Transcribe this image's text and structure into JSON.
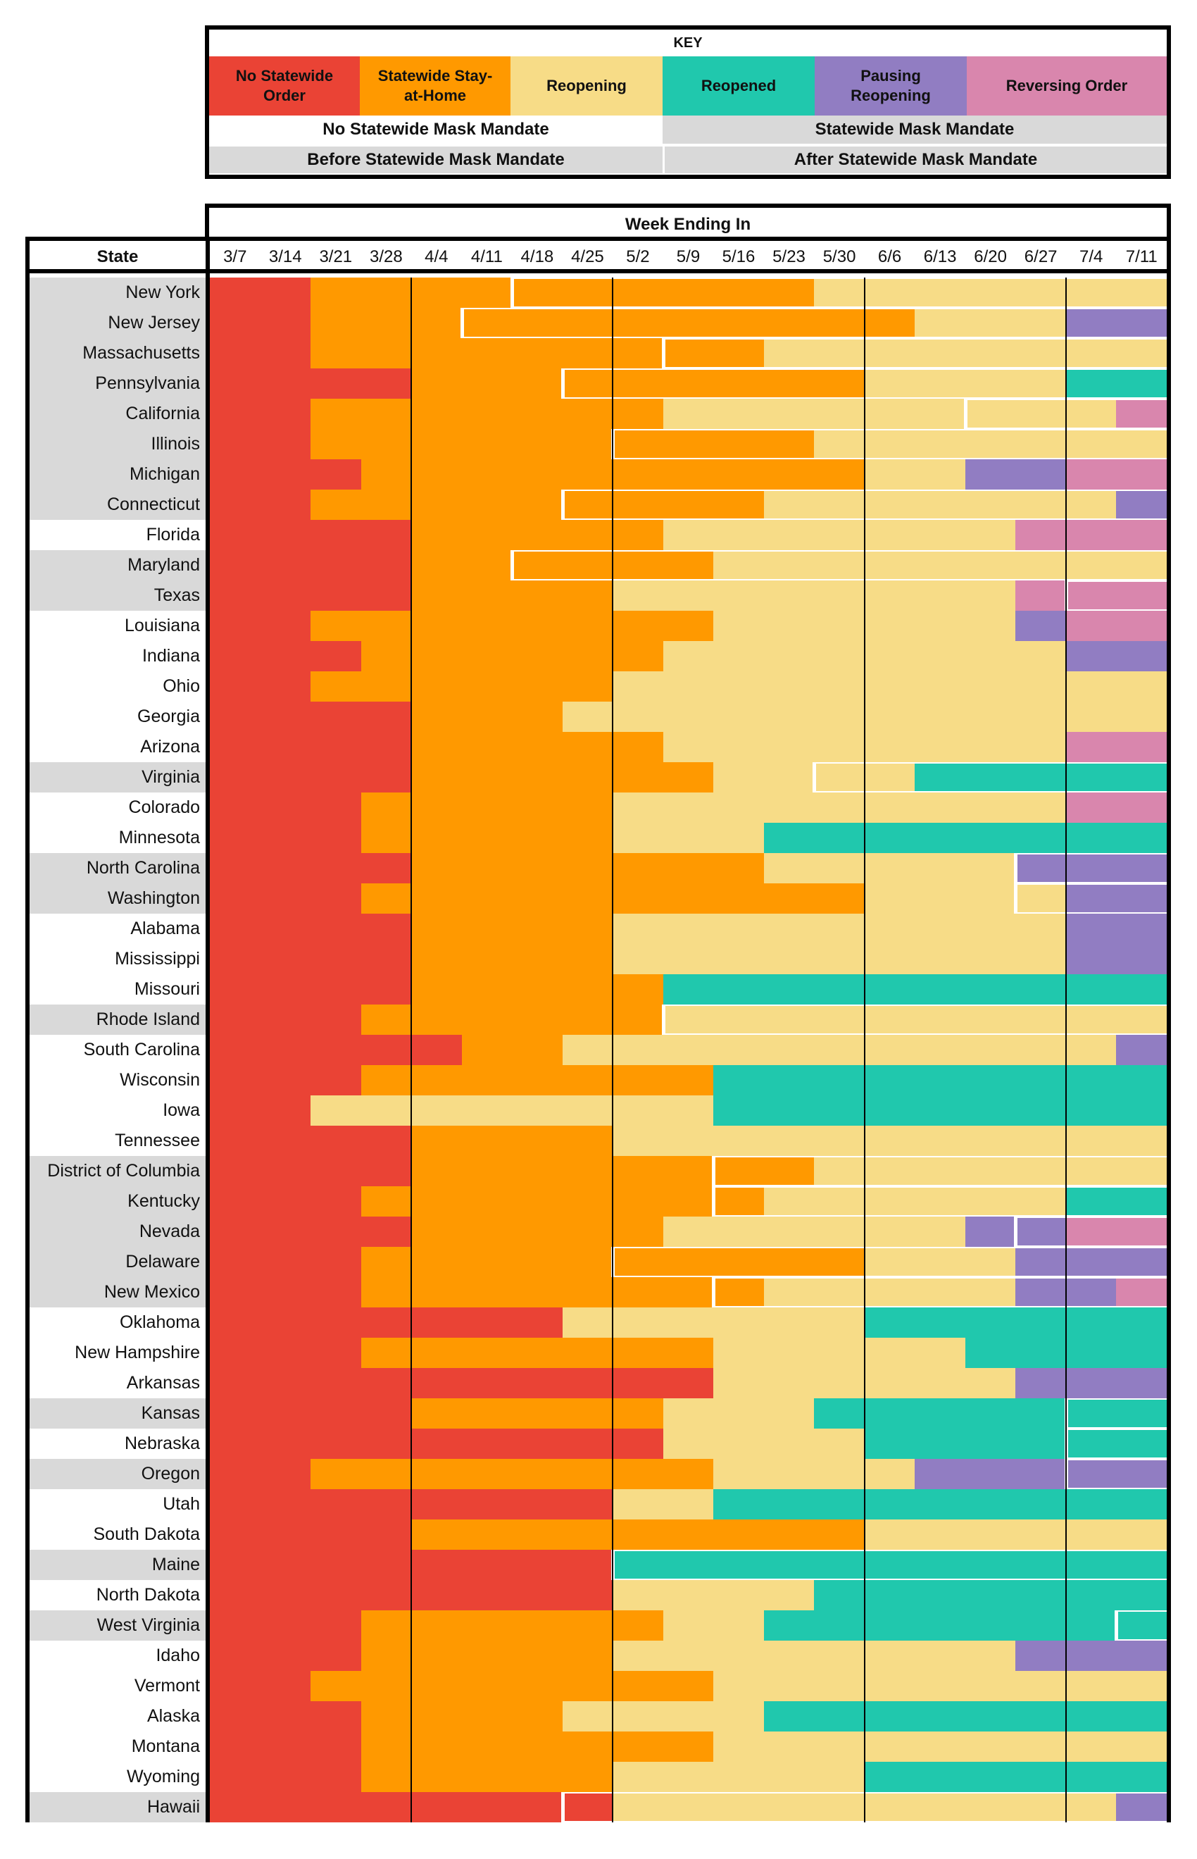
{
  "key": {
    "title": "KEY",
    "statuses": [
      {
        "code": "R",
        "label": "No Statewide Order",
        "color": "#ea4335"
      },
      {
        "code": "O",
        "label": "Statewide Stay-at-Home",
        "color": "#ff9900"
      },
      {
        "code": "Y",
        "label": "Reopening",
        "color": "#f7dc87"
      },
      {
        "code": "T",
        "label": "Reopened",
        "color": "#20c8ad"
      },
      {
        "code": "P",
        "label": "Pausing Reopening",
        "color": "#917dc2"
      },
      {
        "code": "K",
        "label": "Reversing Order",
        "color": "#d986ad"
      }
    ],
    "mask_labels": {
      "no_mandate": "No Statewide Mask Mandate",
      "mandate": "Statewide Mask Mandate",
      "before": "Before Statewide Mask Mandate",
      "after": "After Statewide Mask Mandate"
    },
    "mandate_background": "#d9d9d9"
  },
  "chart_data": {
    "type": "heatmap",
    "title": "Week Ending In",
    "row_header": "State",
    "weeks": [
      "3/7",
      "3/14",
      "3/21",
      "3/28",
      "4/4",
      "4/11",
      "4/18",
      "4/25",
      "5/2",
      "5/9",
      "5/16",
      "5/23",
      "5/30",
      "6/6",
      "6/13",
      "6/20",
      "6/27",
      "7/4",
      "7/11"
    ],
    "status_codes": {
      "R": "No Statewide Order",
      "O": "Statewide Stay-at-Home",
      "Y": "Reopening",
      "T": "Reopened",
      "P": "Pausing Reopening",
      "K": "Reversing Order"
    },
    "states": [
      {
        "name": "New York",
        "mask_mandate": true,
        "mask_start_week": "4/18",
        "weeks": "RROOOOOOOOOOYYYYYYY"
      },
      {
        "name": "New Jersey",
        "mask_mandate": true,
        "mask_start_week": "4/11",
        "weeks": "RROOOOOOOOOOOOYYYPP"
      },
      {
        "name": "Massachusetts",
        "mask_mandate": true,
        "mask_start_week": "5/9",
        "weeks": "RROOOOOOOOOYYYYYYYY"
      },
      {
        "name": "Pennsylvania",
        "mask_mandate": true,
        "mask_start_week": "4/25",
        "weeks": "RRRROOOOOOOOOYYYYTT"
      },
      {
        "name": "California",
        "mask_mandate": true,
        "mask_start_week": "6/20",
        "weeks": "RROOOOOOOYYYYYYYYYK"
      },
      {
        "name": "Illinois",
        "mask_mandate": true,
        "mask_start_week": "5/2",
        "weeks": "RROOOOOOOOOOYYYYYYY"
      },
      {
        "name": "Michigan",
        "mask_mandate": true,
        "mask_start_week": null,
        "weeks": "RRROOOOOOOOOOYYPPKK"
      },
      {
        "name": "Connecticut",
        "mask_mandate": true,
        "mask_start_week": "4/25",
        "weeks": "RROOOOOOOOOYYYYYYYP"
      },
      {
        "name": "Florida",
        "mask_mandate": false,
        "mask_start_week": null,
        "weeks": "RRRROOOOOYYYYYYYKKK"
      },
      {
        "name": "Maryland",
        "mask_mandate": true,
        "mask_start_week": "4/18",
        "weeks": "RRRROOOOOOYYYYYYYYY"
      },
      {
        "name": "Texas",
        "mask_mandate": true,
        "mask_start_week": "7/4",
        "weeks": "RRRROOOOYYYYYYYYKKK"
      },
      {
        "name": "Louisiana",
        "mask_mandate": false,
        "mask_start_week": null,
        "weeks": "RROOOOOOOOYYYYYYPKK"
      },
      {
        "name": "Indiana",
        "mask_mandate": false,
        "mask_start_week": null,
        "weeks": "RRROOOOOOYYYYYYYYPP"
      },
      {
        "name": "Ohio",
        "mask_mandate": false,
        "mask_start_week": null,
        "weeks": "RROOOOOOYYYYYYYYYYY"
      },
      {
        "name": "Georgia",
        "mask_mandate": false,
        "mask_start_week": null,
        "weeks": "RRRROOOYYYYYYYYYYYY"
      },
      {
        "name": "Arizona",
        "mask_mandate": false,
        "mask_start_week": null,
        "weeks": "RRRROOOOOYYYYYYYYKK"
      },
      {
        "name": "Virginia",
        "mask_mandate": true,
        "mask_start_week": "5/30",
        "weeks": "RRRROOOOOOYYYYTTTTT"
      },
      {
        "name": "Colorado",
        "mask_mandate": false,
        "mask_start_week": null,
        "weeks": "RRROOOOOYYYYYYYYYKK"
      },
      {
        "name": "Minnesota",
        "mask_mandate": false,
        "mask_start_week": null,
        "weeks": "RRROOOOOYYYTTTTTTTT"
      },
      {
        "name": "North Carolina",
        "mask_mandate": true,
        "mask_start_week": "6/27",
        "weeks": "RRRROOOOOOOYYYYYPPP"
      },
      {
        "name": "Washington",
        "mask_mandate": true,
        "mask_start_week": "6/27",
        "weeks": "RRROOOOOOOOOOYYYYPP"
      },
      {
        "name": "Alabama",
        "mask_mandate": false,
        "mask_start_week": null,
        "weeks": "RRRROOOOYYYYYYYYYPP"
      },
      {
        "name": "Mississippi",
        "mask_mandate": false,
        "mask_start_week": null,
        "weeks": "RRRROOOOYYYYYYYYYPP"
      },
      {
        "name": "Missouri",
        "mask_mandate": false,
        "mask_start_week": null,
        "weeks": "RRRROOOOOTTTTTTTTTT"
      },
      {
        "name": "Rhode Island",
        "mask_mandate": true,
        "mask_start_week": "5/9",
        "weeks": "RRROOOOOOYYYYYYYYYY"
      },
      {
        "name": "South Carolina",
        "mask_mandate": false,
        "mask_start_week": null,
        "weeks": "RRRRROOYYYYYYYYYYYP"
      },
      {
        "name": "Wisconsin",
        "mask_mandate": false,
        "mask_start_week": null,
        "weeks": "RRROOOOOOOTTTTTTTTT"
      },
      {
        "name": "Iowa",
        "mask_mandate": false,
        "mask_start_week": null,
        "weeks": "RRYYYYYYYYTTTTTTTTT"
      },
      {
        "name": "Tennessee",
        "mask_mandate": false,
        "mask_start_week": null,
        "weeks": "RRRROOOOYYYYYYYYYYY"
      },
      {
        "name": "District of Columbia",
        "mask_mandate": true,
        "mask_start_week": "5/16",
        "weeks": "RRRROOOOOOOOYYYYYYY"
      },
      {
        "name": "Kentucky",
        "mask_mandate": true,
        "mask_start_week": "5/16",
        "weeks": "RRROOOOOOOOYYYYYYTT"
      },
      {
        "name": "Nevada",
        "mask_mandate": true,
        "mask_start_week": "6/27",
        "weeks": "RRRROOOOOYYYYYYPPKK"
      },
      {
        "name": "Delaware",
        "mask_mandate": true,
        "mask_start_week": "5/2",
        "weeks": "RRROOOOOOOOOOYYYPPP"
      },
      {
        "name": "New Mexico",
        "mask_mandate": true,
        "mask_start_week": "5/16",
        "weeks": "RRROOOOOOOOYYYYYPPK"
      },
      {
        "name": "Oklahoma",
        "mask_mandate": false,
        "mask_start_week": null,
        "weeks": "RRRRRRRYYYYYYTTTTTT"
      },
      {
        "name": "New Hampshire",
        "mask_mandate": false,
        "mask_start_week": null,
        "weeks": "RRROOOOOOOYYYYYTTTT"
      },
      {
        "name": "Arkansas",
        "mask_mandate": false,
        "mask_start_week": null,
        "weeks": "RRRRRRRRRRYYYYYYPPP"
      },
      {
        "name": "Kansas",
        "mask_mandate": true,
        "mask_start_week": "7/4",
        "weeks": "RRRROOOOOYYYTTTTTTT"
      },
      {
        "name": "Nebraska",
        "mask_mandate": false,
        "mask_start_week": "7/4",
        "weeks": "RRRRRRRRRYYYYTTTTTT"
      },
      {
        "name": "Oregon",
        "mask_mandate": true,
        "mask_start_week": "7/4",
        "weeks": "RROOOOOOOOYYYYPPPPP"
      },
      {
        "name": "Utah",
        "mask_mandate": false,
        "mask_start_week": null,
        "weeks": "RRRRRRRRYYTTTTTTTTT"
      },
      {
        "name": "South Dakota",
        "mask_mandate": false,
        "mask_start_week": null,
        "weeks": "RRRROOOOOOOOOYYYYYY"
      },
      {
        "name": "Maine",
        "mask_mandate": true,
        "mask_start_week": "5/2",
        "weeks": "RRRRRRRRTTTTTTTTTTT"
      },
      {
        "name": "North Dakota",
        "mask_mandate": false,
        "mask_start_week": null,
        "weeks": "RRRRRRRRYYYYTTTTTTT"
      },
      {
        "name": "West Virginia",
        "mask_mandate": true,
        "mask_start_week": "7/11",
        "weeks": "RRROOOOOOYYTTTTTTTT"
      },
      {
        "name": "Idaho",
        "mask_mandate": false,
        "mask_start_week": null,
        "weeks": "RRROOOOOYYYYYYYYPPP"
      },
      {
        "name": "Vermont",
        "mask_mandate": false,
        "mask_start_week": null,
        "weeks": "RROOOOOOOOYYYYYYYYY"
      },
      {
        "name": "Alaska",
        "mask_mandate": false,
        "mask_start_week": null,
        "weeks": "RRROOOOYYYYTTTTTTTT"
      },
      {
        "name": "Montana",
        "mask_mandate": false,
        "mask_start_week": null,
        "weeks": "RRROOOOOOOYYYYYYYYY"
      },
      {
        "name": "Wyoming",
        "mask_mandate": false,
        "mask_start_week": null,
        "weeks": "RRROOOOOYYYYYTTTTTT"
      },
      {
        "name": "Hawaii",
        "mask_mandate": true,
        "mask_start_week": "4/25",
        "weeks": "RRRRRRRRYYYYYYYYYYP"
      }
    ],
    "month_divider_weeks": [
      "4/4",
      "5/2",
      "6/6",
      "7/4"
    ]
  }
}
